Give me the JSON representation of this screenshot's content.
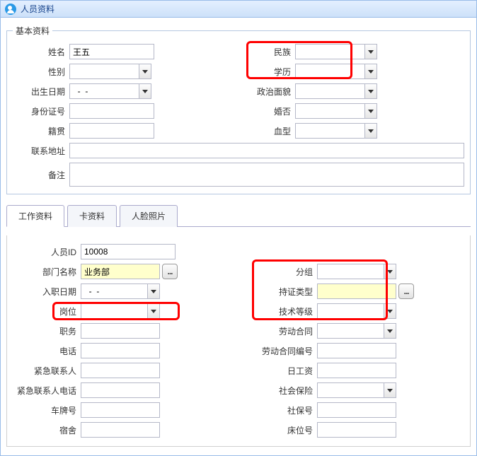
{
  "window": {
    "title": "人员资料"
  },
  "basic": {
    "legend": "基本资料",
    "name_label": "姓名",
    "name_value": "王五",
    "gender_label": "性别",
    "gender_value": "",
    "birth_label": "出生日期",
    "birth_value": "  -  -",
    "idnum_label": "身份证号",
    "idnum_value": "",
    "native_label": "籍贯",
    "native_value": "",
    "address_label": "联系地址",
    "address_value": "",
    "remark_label": "备注",
    "remark_value": "",
    "nation_label": "民族",
    "nation_value": "",
    "edu_label": "学历",
    "edu_value": "",
    "politics_label": "政治面貌",
    "politics_value": "",
    "marriage_label": "婚否",
    "marriage_value": "",
    "blood_label": "血型",
    "blood_value": ""
  },
  "tabs": {
    "work": "工作资料",
    "card": "卡资料",
    "face": "人脸照片"
  },
  "work": {
    "personid_label": "人员ID",
    "personid_value": "10008",
    "dept_label": "部门名称",
    "dept_value": "业务部",
    "hiredate_label": "入职日期",
    "hiredate_value": "  -  -",
    "post_label": "岗位",
    "post_value": "",
    "duty_label": "职务",
    "duty_value": "",
    "phone_label": "电话",
    "phone_value": "",
    "emgcontact_label": "紧急联系人",
    "emgcontact_value": "",
    "emgphone_label": "紧急联系人电话",
    "emgphone_value": "",
    "car_label": "车牌号",
    "car_value": "",
    "dorm_label": "宿舍",
    "dorm_value": "",
    "group_label": "分组",
    "group_value": "",
    "cardtype_label": "持证类型",
    "cardtype_value": "",
    "skill_label": "技术等级",
    "skill_value": "",
    "contract_label": "劳动合同",
    "contract_value": "",
    "contractno_label": "劳动合同编号",
    "contractno_value": "",
    "dailywage_label": "日工资",
    "dailywage_value": "",
    "insurance_label": "社会保险",
    "insurance_value": "",
    "ssn_label": "社保号",
    "ssn_value": "",
    "bed_label": "床位号",
    "bed_value": ""
  },
  "lookup_ellipsis": "..."
}
